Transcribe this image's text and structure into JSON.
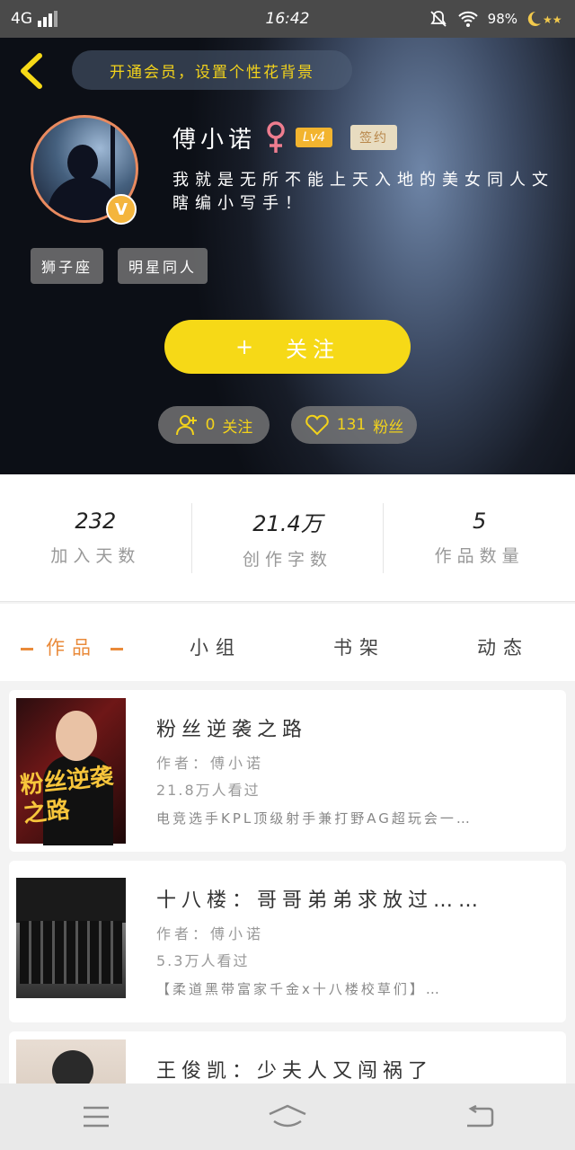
{
  "status_bar": {
    "network": "4G",
    "time": "16:42",
    "battery": "98%"
  },
  "header": {
    "background_tip": "开通会员，设置个性花背景",
    "avatar_badge": "V",
    "name": "傅小诺",
    "level": "Lv4",
    "signed": "签约",
    "bio": "我就是无所不能上天入地的美女同人文瞎编小写手！",
    "tags": [
      "狮子座",
      "明星同人"
    ],
    "follow_button": {
      "icon": "+",
      "label": "关注"
    },
    "following": {
      "count": "0",
      "label": "关注"
    },
    "fans": {
      "count": "131",
      "label": "粉丝"
    }
  },
  "stats": [
    {
      "value": "232",
      "label": "加入天数"
    },
    {
      "value": "21.4万",
      "label": "创作字数"
    },
    {
      "value": "5",
      "label": "作品数量"
    }
  ],
  "tabs": [
    "作品",
    "小组",
    "书架",
    "动态"
  ],
  "books": [
    {
      "title": "粉丝逆袭之路",
      "author": "作者：傅小诺",
      "reads": "21.8万人看过",
      "desc": "电竞选手KPL顶级射手兼打野AG超玩会一…",
      "cover_text": "粉丝逆袭之路"
    },
    {
      "title": "十八楼：哥哥弟弟求放过……",
      "author": "作者：傅小诺",
      "reads": "5.3万人看过",
      "desc": "【柔道黑带富家千金x十八楼校草们】…"
    },
    {
      "title": "王俊凯：少夫人又闯祸了",
      "author": "",
      "reads": "",
      "desc": ""
    }
  ],
  "colors": {
    "accent_yellow": "#f6d917",
    "accent_orange": "#e98a3a",
    "tip_text": "#f2d21b"
  }
}
